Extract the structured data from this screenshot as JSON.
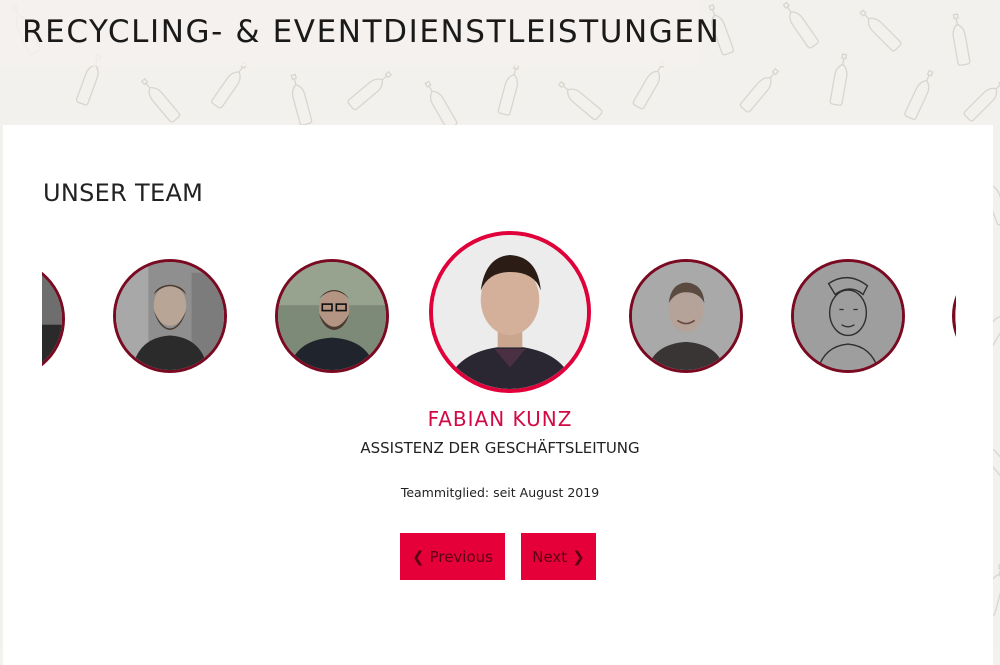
{
  "header": {
    "title": "RECYCLING- & EVENTDIENSTLEISTUNGEN"
  },
  "team_section": {
    "heading": "UNSER TEAM",
    "members": [
      {
        "photo": "person-photo-partial-left"
      },
      {
        "photo": "bearded-man-photo"
      },
      {
        "photo": "man-glasses-beard-photo"
      },
      {
        "photo": "fabian-kunz-photo",
        "active": true
      },
      {
        "photo": "smiling-man-photo"
      },
      {
        "photo": "sketch-portrait-photo"
      },
      {
        "photo": "person-photo-partial-right"
      }
    ],
    "active_member": {
      "name": "FABIAN KUNZ",
      "role": "ASSISTENZ DER GESCHÄFTSLEITUNG",
      "since": "Teammitglied: seit August 2019"
    },
    "controls": {
      "previous_label": "Previous",
      "next_label": "Next",
      "previous_icon": "chevron-left-icon",
      "next_icon": "chevron-right-icon"
    }
  },
  "colors": {
    "accent": "#e5003a",
    "name_color": "#d10a45",
    "avatar_border": "#7a0a22",
    "background": "#f3f1ed"
  }
}
